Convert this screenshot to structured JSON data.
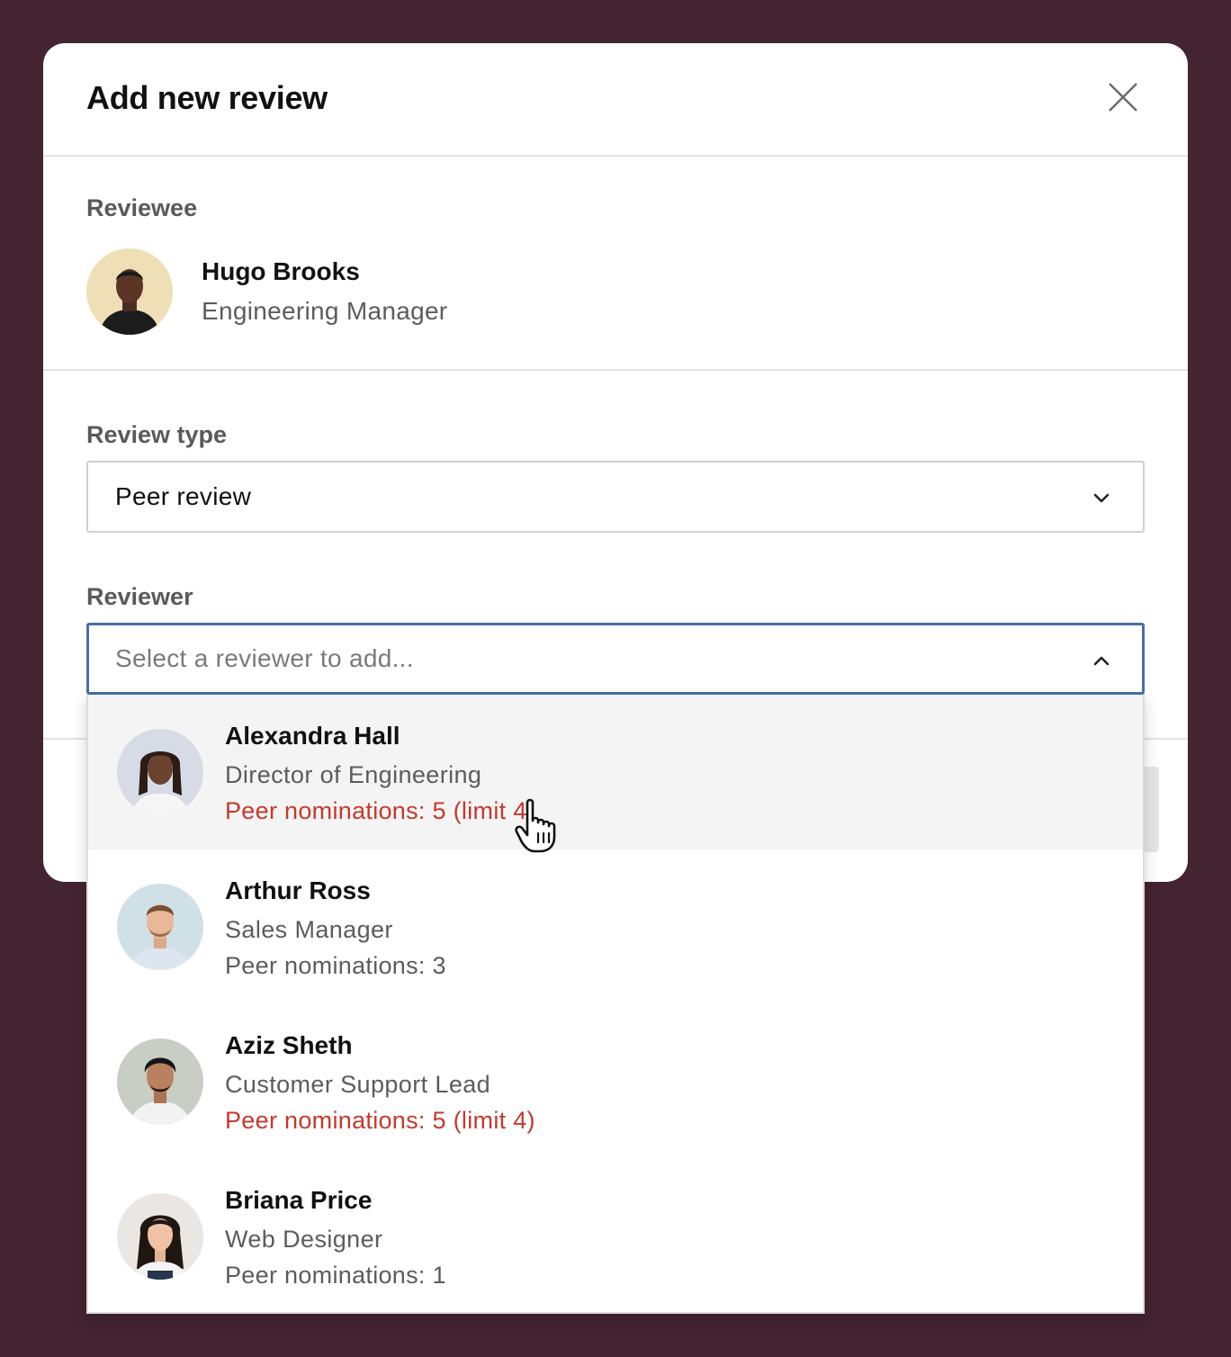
{
  "modal": {
    "title": "Add new review",
    "close_icon": "close-icon"
  },
  "reviewee": {
    "label": "Reviewee",
    "name": "Hugo Brooks",
    "role": "Engineering Manager"
  },
  "review_type": {
    "label": "Review type",
    "value": "Peer review",
    "icon": "chevron-down-icon"
  },
  "reviewer": {
    "label": "Reviewer",
    "placeholder": "Select a reviewer to add...",
    "icon": "chevron-up-icon",
    "options": [
      {
        "name": "Alexandra Hall",
        "role": "Director of Engineering",
        "nominations": "Peer nominations: 5 (limit 4)",
        "over_limit": true,
        "hovered": true
      },
      {
        "name": "Arthur Ross",
        "role": "Sales Manager",
        "nominations": "Peer nominations: 3",
        "over_limit": false
      },
      {
        "name": "Aziz Sheth",
        "role": "Customer Support Lead",
        "nominations": "Peer nominations: 5 (limit 4)",
        "over_limit": true
      },
      {
        "name": "Briana Price",
        "role": "Web Designer",
        "nominations": "Peer nominations: 1",
        "over_limit": false
      }
    ]
  },
  "colors": {
    "backdrop": "#432430",
    "warning": "#c5392c",
    "focus_border": "#4a6ea9"
  }
}
